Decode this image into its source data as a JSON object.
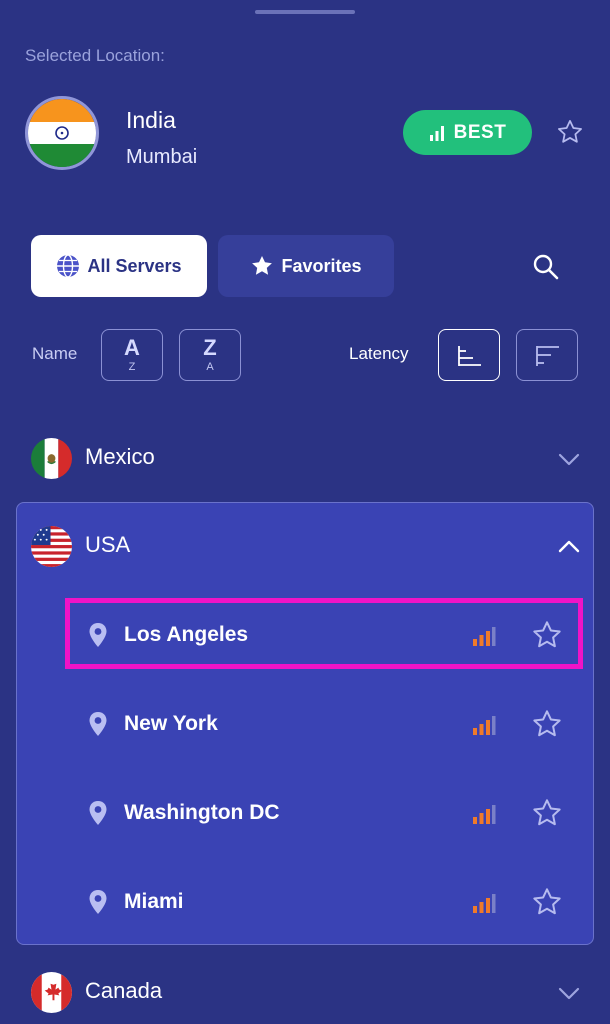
{
  "selected": {
    "label": "Selected Location:",
    "country": "India",
    "city": "Mumbai",
    "badge": "BEST",
    "flag_icon": "india-flag"
  },
  "tabs": [
    {
      "label": "All Servers",
      "icon": "globe-icon",
      "active": true
    },
    {
      "label": "Favorites",
      "icon": "star-icon",
      "active": false
    }
  ],
  "sort": {
    "name_label": "Name",
    "az_big": "A",
    "az_small": "Z",
    "za_big": "Z",
    "za_small": "A",
    "latency_label": "Latency",
    "active": "latency-ascending"
  },
  "countries": [
    {
      "name": "Mexico",
      "flag_icon": "mexico-flag",
      "expanded": false
    },
    {
      "name": "USA",
      "flag_icon": "usa-flag",
      "expanded": true,
      "cities": [
        {
          "name": "Los Angeles",
          "signal_bars": 3,
          "highlighted": true
        },
        {
          "name": "New York",
          "signal_bars": 3
        },
        {
          "name": "Washington DC",
          "signal_bars": 3
        },
        {
          "name": "Miami",
          "signal_bars": 3
        }
      ]
    },
    {
      "name": "Canada",
      "flag_icon": "canada-flag",
      "expanded": false
    }
  ],
  "colors": {
    "background": "#2b3384",
    "expanded_panel": "#3a43b4",
    "best_badge": "#22c07c",
    "signal_orange": "#f07a2a",
    "highlight": "#f013c7"
  }
}
